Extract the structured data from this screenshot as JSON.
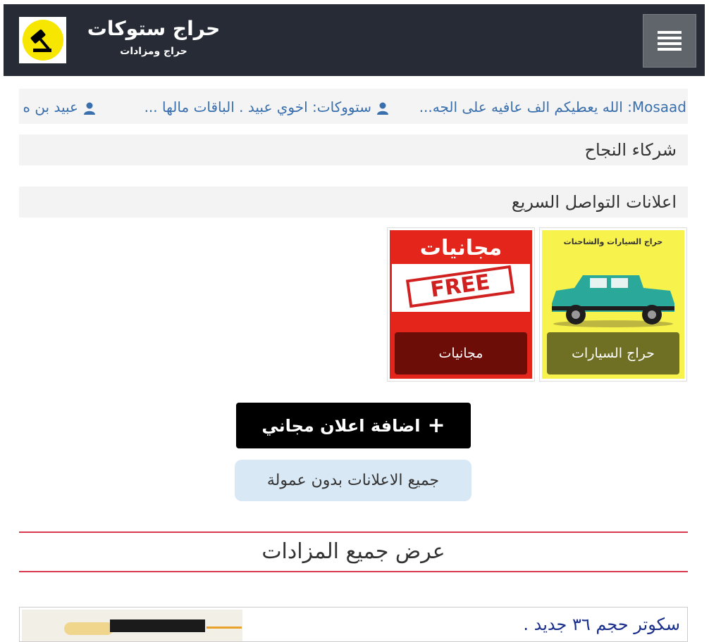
{
  "header": {
    "title": "حراج ستوكات",
    "subtitle": "حراج ومزادات",
    "logo_icon": "gavel-icon",
    "menu_icon": "hamburger-icon"
  },
  "ticker": {
    "items": [
      {
        "author": "Mosaad",
        "text": ": الله يعطيكم الف عافيه على الجه..."
      },
      {
        "author": "ستووكات",
        "text": ": اخوي عبيد . الباقات مالها ..."
      },
      {
        "author": "عبيد بن ه",
        "text": ""
      }
    ]
  },
  "sections": {
    "partners": "شركاء النجاح",
    "quick_ads": "اعلانات التواصل السريع"
  },
  "cards": [
    {
      "label": "حراج السيارات",
      "image_caption": "حراج السيارات والشاحنات",
      "color": "#f8f24c",
      "label_bg": "#707024"
    },
    {
      "label": "مجانيات",
      "image_title": "مجانيات",
      "stamp": "FREE",
      "color": "#e3251c",
      "label_bg": "#6d0d08"
    }
  ],
  "buttons": {
    "add_ad": "اضافة اعلان مجاني",
    "add_icon": "plus-icon",
    "all_ads": "جميع الاعلانات بدون عمولة"
  },
  "auctions": {
    "title": "عرض جميع المزادات"
  },
  "listing": {
    "title": "سكوتر حجم ٣٦ جديد ."
  },
  "colors": {
    "header_bg": "#262b35",
    "accent_red": "#d9394e",
    "link_blue": "#3a6fad"
  }
}
